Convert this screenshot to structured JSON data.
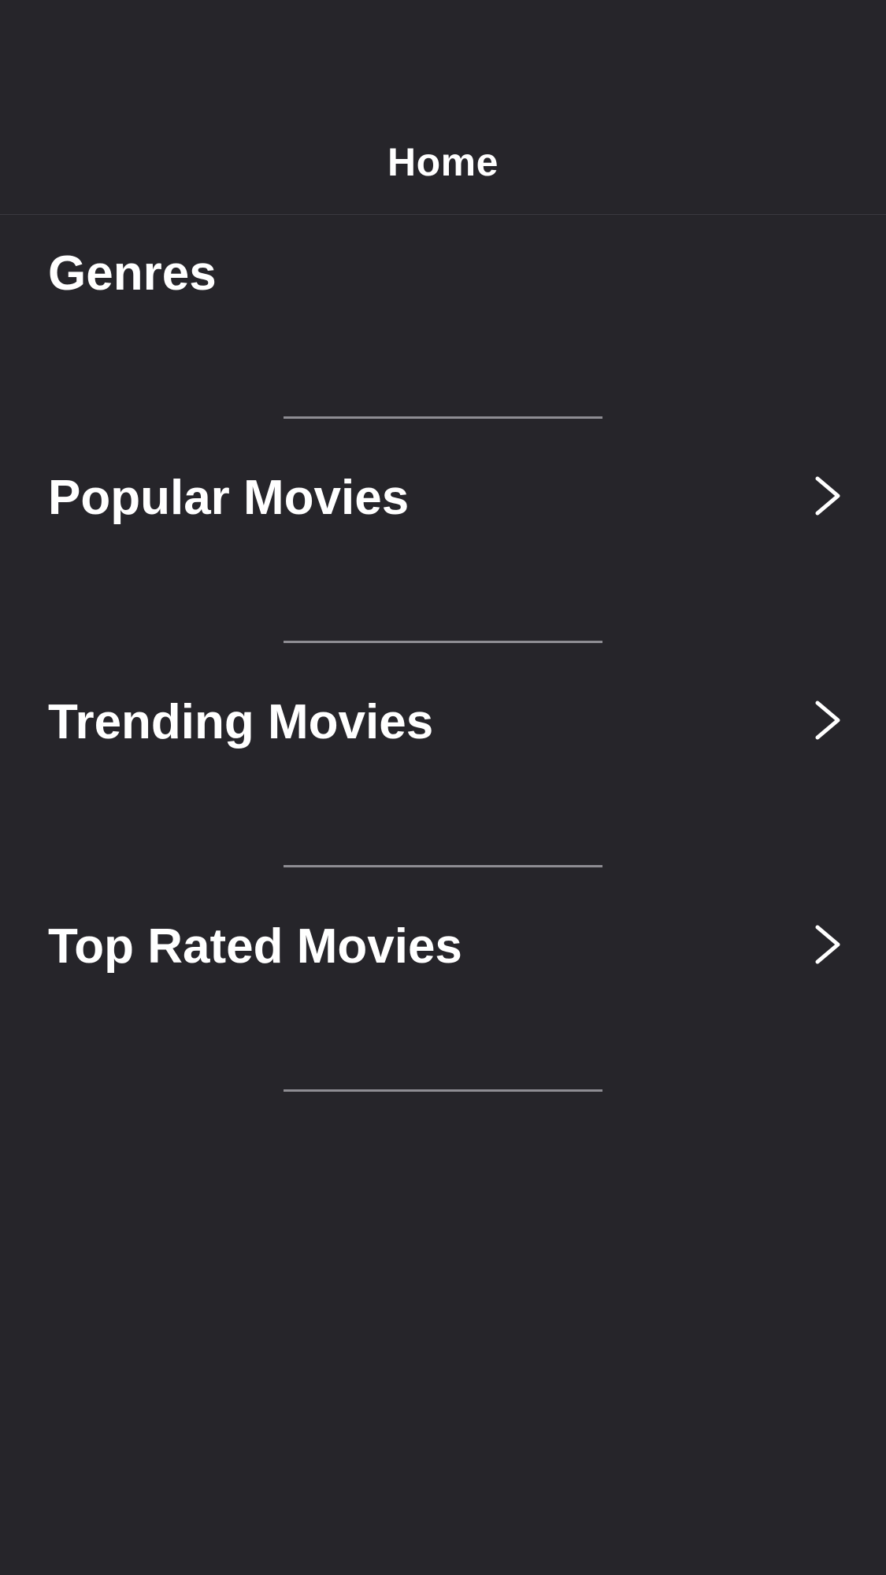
{
  "nav": {
    "title": "Home"
  },
  "section": {
    "title": "Genres"
  },
  "menu": {
    "items": [
      {
        "label": "Popular Movies",
        "icon": "chevron-right-icon"
      },
      {
        "label": "Trending Movies",
        "icon": "chevron-right-icon"
      },
      {
        "label": "Top Rated Movies",
        "icon": "chevron-right-icon"
      }
    ]
  },
  "colors": {
    "background": "#26252a",
    "text": "#ffffff",
    "divider": "#8e8d93"
  }
}
